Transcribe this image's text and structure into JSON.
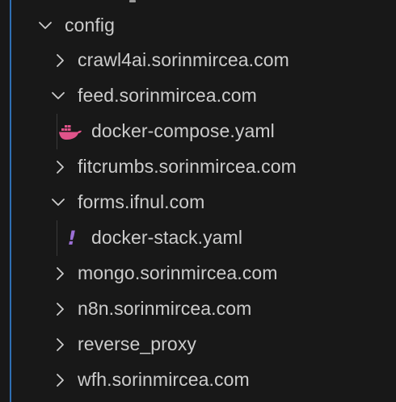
{
  "colors": {
    "background": "#181818",
    "text": "#cccccc",
    "accent_line": "#2f6fb3",
    "docker_icon": "#e0538a",
    "yaml_icon": "#9b6fd6"
  },
  "tree": {
    "root": {
      "label": "config",
      "expanded": true,
      "icon": "chevron-down-icon"
    },
    "items": [
      {
        "label": "crawl4ai.sorinmircea.com",
        "type": "folder",
        "expanded": false
      },
      {
        "label": "feed.sorinmircea.com",
        "type": "folder",
        "expanded": true,
        "children": [
          {
            "label": "docker-compose.yaml",
            "type": "file",
            "icon": "docker-icon"
          }
        ]
      },
      {
        "label": "fitcrumbs.sorinmircea.com",
        "type": "folder",
        "expanded": false
      },
      {
        "label": "forms.ifnul.com",
        "type": "folder",
        "expanded": true,
        "children": [
          {
            "label": "docker-stack.yaml",
            "type": "file",
            "icon": "yaml-exclamation-icon",
            "glyph": "!"
          }
        ]
      },
      {
        "label": "mongo.sorinmircea.com",
        "type": "folder",
        "expanded": false
      },
      {
        "label": "n8n.sorinmircea.com",
        "type": "folder",
        "expanded": false
      },
      {
        "label": "reverse_proxy",
        "type": "folder",
        "expanded": false
      },
      {
        "label": "wfh.sorinmircea.com",
        "type": "folder",
        "expanded": false
      }
    ]
  }
}
